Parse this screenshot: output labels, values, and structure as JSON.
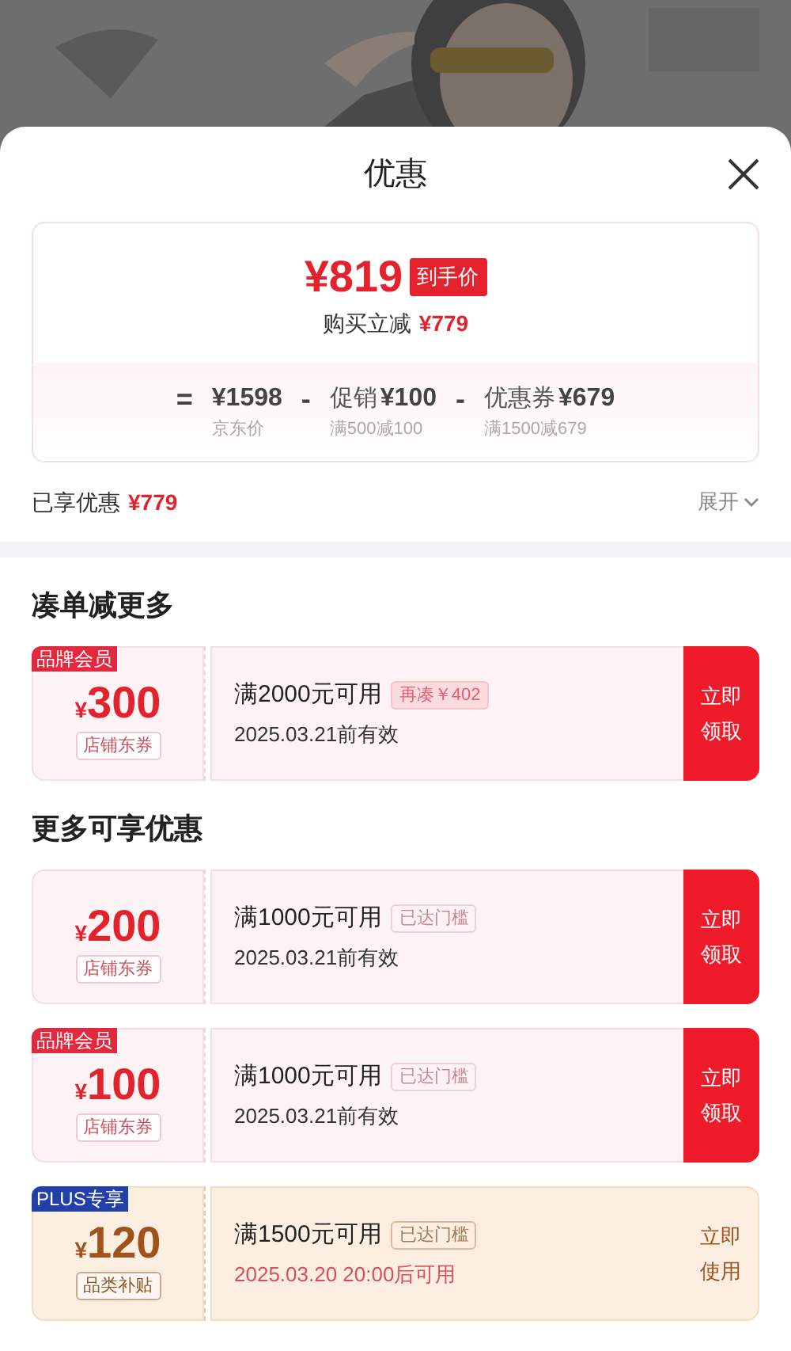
{
  "sheet": {
    "title": "优惠"
  },
  "price_card": {
    "final_price": "¥819",
    "price_tag": "到手价",
    "instant_discount_label": "购买立减",
    "instant_discount": "¥779",
    "equals_sign": "=",
    "terms": [
      {
        "amount": "¥1598",
        "note": "京东价"
      },
      {
        "operator": "-",
        "label": "促销",
        "amount": "¥100",
        "note": "满500减100"
      },
      {
        "operator": "-",
        "label": "优惠券",
        "amount": "¥679",
        "note": "满1500减679"
      }
    ]
  },
  "summary": {
    "label": "已享优惠",
    "amount": "¥779",
    "toggle": "展开"
  },
  "sections": [
    {
      "title": "凑单减更多",
      "coupons": [
        {
          "kind": "standard",
          "tag": "品牌会员",
          "currency": "¥",
          "amount": "300",
          "type_label": "店铺东券",
          "condition": "满2000元可用",
          "badge": {
            "kind": "shortfall",
            "text": "再凑￥402"
          },
          "validity": "2025.03.21前有效",
          "action": "立即领取"
        }
      ]
    },
    {
      "title": "更多可享优惠",
      "coupons": [
        {
          "kind": "standard",
          "currency": "¥",
          "amount": "200",
          "type_label": "店铺东券",
          "condition": "满1000元可用",
          "badge": {
            "kind": "reached",
            "text": "已达门槛"
          },
          "validity": "2025.03.21前有效",
          "action": "立即领取"
        },
        {
          "kind": "standard",
          "tag": "品牌会员",
          "currency": "¥",
          "amount": "100",
          "type_label": "店铺东券",
          "condition": "满1000元可用",
          "badge": {
            "kind": "reached",
            "text": "已达门槛"
          },
          "validity": "2025.03.21前有效",
          "action": "立即领取"
        },
        {
          "kind": "plus",
          "tag": "PLUS专享",
          "currency": "¥",
          "amount": "120",
          "type_label": "品类补贴",
          "condition": "满1500元可用",
          "badge": {
            "kind": "reached",
            "text": "已达门槛"
          },
          "validity": "2025.03.20 20:00后可用",
          "action": "立即使用"
        }
      ]
    }
  ]
}
